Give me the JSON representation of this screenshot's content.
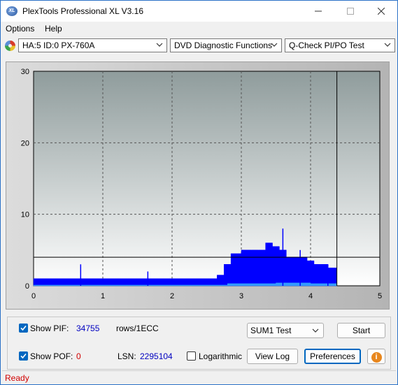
{
  "titlebar": {
    "title": "PlexTools Professional XL V3.16",
    "app_icon_text": "XL"
  },
  "menu": {
    "options": "Options",
    "help": "Help"
  },
  "toolbar": {
    "drive": "HA:5 ID:0  PX-760A",
    "function": "DVD Diagnostic Functions",
    "test": "Q-Check PI/PO Test"
  },
  "chart_data": {
    "type": "area",
    "xlim": [
      0,
      5
    ],
    "ylim": [
      0,
      30
    ],
    "x_ticks": [
      "0",
      "1",
      "2",
      "3",
      "4",
      "5"
    ],
    "y_ticks": [
      "0",
      "10",
      "20",
      "30"
    ],
    "grid": true,
    "threshold_line": 4,
    "end_marker_x": 4.38,
    "series": [
      {
        "color": "#0000ff",
        "x": [
          0.0,
          0.5,
          1.0,
          1.5,
          2.0,
          2.5,
          2.65,
          2.75,
          2.85,
          3.0,
          3.15,
          3.25,
          3.35,
          3.45,
          3.55,
          3.65,
          3.75,
          3.85,
          3.95,
          4.05,
          4.15,
          4.25,
          4.38
        ],
        "values": [
          1,
          1,
          1,
          1,
          1,
          1,
          1.5,
          3,
          4.5,
          5,
          5,
          5,
          6,
          5.5,
          5,
          4,
          4,
          4,
          3.5,
          3,
          3,
          2.5,
          2
        ]
      },
      {
        "color": "#3399ff",
        "x": [
          0.0,
          2.7,
          2.8,
          3.5,
          4.0,
          4.38
        ],
        "values": [
          0.1,
          0.1,
          0.3,
          0.4,
          0.3,
          0.3
        ]
      }
    ],
    "spikes": [
      {
        "x": 0.68,
        "y": 3
      },
      {
        "x": 1.65,
        "y": 2
      },
      {
        "x": 3.6,
        "y": 8
      },
      {
        "x": 3.85,
        "y": 5
      },
      {
        "x": 4.25,
        "y": 3
      }
    ]
  },
  "panel": {
    "show_pif_label": "Show PIF:",
    "pif_value": "34755",
    "pif_unit": "rows/1ECC",
    "show_pof_label": "Show POF:",
    "pof_value": "0",
    "lsn_label": "LSN:",
    "lsn_value": "2295104",
    "logarithmic_label": "Logarithmic",
    "sum_select": "SUM1 Test",
    "start_button": "Start",
    "view_log_button": "View Log",
    "preferences_button": "Preferences",
    "info_icon_text": "i"
  },
  "status": {
    "text": "Ready"
  },
  "colors": {
    "accent": "#0067c0",
    "status_red": "#d00000",
    "series": "#0000ff"
  }
}
